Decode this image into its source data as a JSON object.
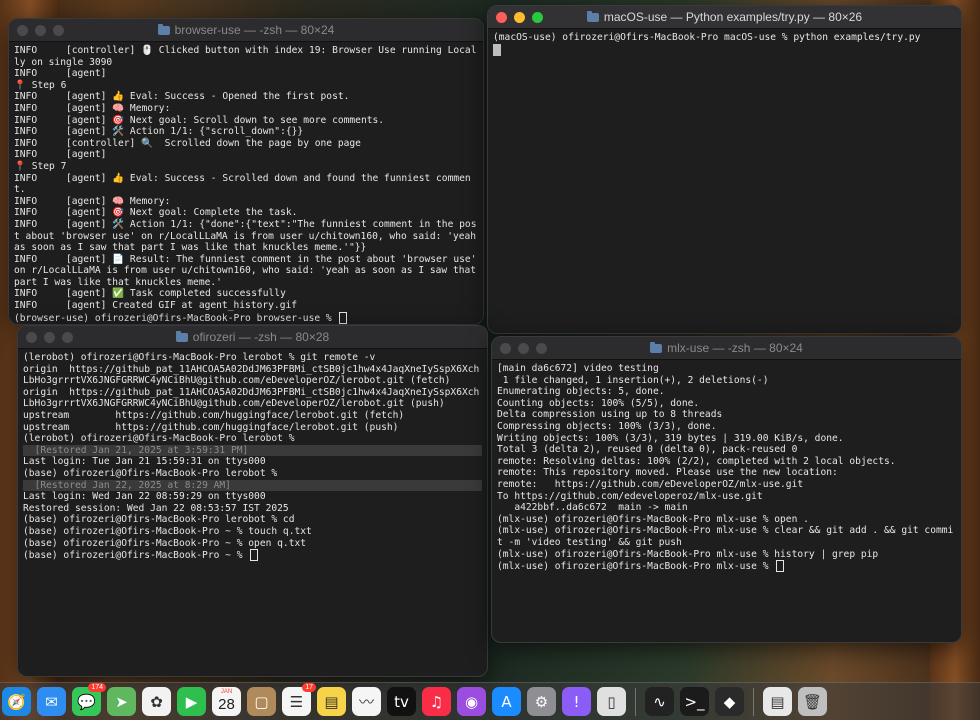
{
  "windows": {
    "browser": {
      "title": "browser-use — -zsh — 80×24",
      "lines": [
        "INFO     [controller] 🖱️ Clicked button with index 19: Browser Use running Locally on single 3090",
        "INFO     [agent]",
        "📍 Step 6",
        "INFO     [agent] 👍 Eval: Success - Opened the first post.",
        "INFO     [agent] 🧠 Memory:",
        "INFO     [agent] 🎯 Next goal: Scroll down to see more comments.",
        "INFO     [agent] 🛠️ Action 1/1: {\"scroll_down\":{}}",
        "INFO     [controller] 🔍  Scrolled down the page by one page",
        "INFO     [agent]",
        "📍 Step 7",
        "INFO     [agent] 👍 Eval: Success - Scrolled down and found the funniest comment.",
        "INFO     [agent] 🧠 Memory:",
        "INFO     [agent] 🎯 Next goal: Complete the task.",
        "INFO     [agent] 🛠️ Action 1/1: {\"done\":{\"text\":\"The funniest comment in the post about 'browser use' on r/LocalLLaMA is from user u/chitown160, who said: 'yeah as soon as I saw that part I was like that knuckles meme.'\"}}",
        "INFO     [agent] 📄 Result: The funniest comment in the post about 'browser use' on r/LocalLLaMA is from user u/chitown160, who said: 'yeah as soon as I saw that part I was like that knuckles meme.'",
        "INFO     [agent] ✅ Task completed successfully",
        "INFO     [agent] Created GIF at agent_history.gif"
      ],
      "prompt": "(browser-use) ofirozeri@Ofirs-MacBook-Pro browser-use % "
    },
    "macos": {
      "title": "macOS-use — Python examples/try.py — 80×26",
      "lines": [
        "(macOS-use) ofirozeri@Ofirs-MacBook-Pro macOS-use % python examples/try.py"
      ]
    },
    "lerobot": {
      "title": "ofirozeri — -zsh — 80×28",
      "lines": [
        {
          "text": "(lerobot) ofirozeri@Ofirs-MacBook-Pro lerobot % git remote -v",
          "restored": false
        },
        {
          "text": "origin  https://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@github.com/eDeveloperOZ/lerobot.git (fetch)",
          "restored": false
        },
        {
          "text": "origin  https://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@github.com/eDeveloperOZ/lerobot.git (push)",
          "restored": false
        },
        {
          "text": "upstream        https://github.com/huggingface/lerobot.git (fetch)",
          "restored": false
        },
        {
          "text": "upstream        https://github.com/huggingface/lerobot.git (push)",
          "restored": false
        },
        {
          "text": "(lerobot) ofirozeri@Ofirs-MacBook-Pro lerobot %",
          "restored": false
        },
        {
          "text": "  [Restored Jan 21, 2025 at 3:59:31 PM]",
          "restored": true
        },
        {
          "text": "Last login: Tue Jan 21 15:59:31 on ttys000",
          "restored": false
        },
        {
          "text": "(base) ofirozeri@Ofirs-MacBook-Pro lerobot %",
          "restored": false
        },
        {
          "text": "  [Restored Jan 22, 2025 at 8:29 AM]",
          "restored": true
        },
        {
          "text": "Last login: Wed Jan 22 08:59:29 on ttys000",
          "restored": false
        },
        {
          "text": "Restored session: Wed Jan 22 08:53:57 IST 2025",
          "restored": false
        },
        {
          "text": "(base) ofirozeri@Ofirs-MacBook-Pro lerobot % cd",
          "restored": false
        },
        {
          "text": "(base) ofirozeri@Ofirs-MacBook-Pro ~ % touch q.txt",
          "restored": false
        },
        {
          "text": "(base) ofirozeri@Ofirs-MacBook-Pro ~ % open q.txt",
          "restored": false
        }
      ],
      "prompt": "(base) ofirozeri@Ofirs-MacBook-Pro ~ % "
    },
    "mlx": {
      "title": "mlx-use — -zsh — 80×24",
      "lines": [
        "[main da6c672] video testing",
        " 1 file changed, 1 insertion(+), 2 deletions(-)",
        "Enumerating objects: 5, done.",
        "Counting objects: 100% (5/5), done.",
        "Delta compression using up to 8 threads",
        "Compressing objects: 100% (3/3), done.",
        "Writing objects: 100% (3/3), 319 bytes | 319.00 KiB/s, done.",
        "Total 3 (delta 2), reused 0 (delta 0), pack-reused 0",
        "remote: Resolving deltas: 100% (2/2), completed with 2 local objects.",
        "remote: This repository moved. Please use the new location:",
        "remote:   https://github.com/eDeveloperOZ/mlx-use.git",
        "To https://github.com/edeveloperoz/mlx-use.git",
        "   a422bbf..da6c672  main -> main",
        "(mlx-use) ofirozeri@Ofirs-MacBook-Pro mlx-use % open .",
        "(mlx-use) ofirozeri@Ofirs-MacBook-Pro mlx-use % clear && git add . && git commit -m 'video testing' && git push",
        "(mlx-use) ofirozeri@Ofirs-MacBook-Pro mlx-use % history | grep pip"
      ],
      "prompt": "(mlx-use) ofirozeri@Ofirs-MacBook-Pro mlx-use % "
    }
  },
  "dock": {
    "apps": [
      {
        "name": "safari-icon",
        "glyph": "🧭",
        "color": "#1e88e5"
      },
      {
        "name": "mail-icon",
        "glyph": "✉",
        "color": "#2f8cf0"
      },
      {
        "name": "messages-icon",
        "glyph": "💬",
        "color": "#34c759",
        "badge": "174"
      },
      {
        "name": "maps-icon",
        "glyph": "➤",
        "color": "#5fb85f"
      },
      {
        "name": "photos-icon",
        "glyph": "✿",
        "color": "#f2f2f2"
      },
      {
        "name": "facetime-icon",
        "glyph": "▶",
        "color": "#2fbf4f"
      },
      {
        "name": "calendar-icon",
        "glyph": "",
        "color": "#f5f5f5",
        "month": "JAN",
        "day": "28"
      },
      {
        "name": "finder-app-icon",
        "glyph": "▢",
        "color": "#b08a5a"
      },
      {
        "name": "reminders-icon",
        "glyph": "☰",
        "color": "#f5f5f5",
        "badge": "17"
      },
      {
        "name": "notes-icon",
        "glyph": "▤",
        "color": "#f7d34a"
      },
      {
        "name": "freeform-icon",
        "glyph": "〰",
        "color": "#f5f5f5"
      },
      {
        "name": "appletv-icon",
        "glyph": "tv",
        "color": "#111111"
      },
      {
        "name": "music-icon",
        "glyph": "♫",
        "color": "#fa2d48"
      },
      {
        "name": "podcasts-icon",
        "glyph": "◉",
        "color": "#9b4de0"
      },
      {
        "name": "appstore-icon",
        "glyph": "A",
        "color": "#1a8cff"
      },
      {
        "name": "settings-icon",
        "glyph": "⚙",
        "color": "#8e8e93"
      },
      {
        "name": "feedback-icon",
        "glyph": "!",
        "color": "#8b5cf6"
      },
      {
        "name": "iphone-mirroring-icon",
        "glyph": "▯",
        "color": "#e0e0e0"
      }
    ],
    "apps2": [
      {
        "name": "activity-monitor-icon",
        "glyph": "∿",
        "color": "#222222"
      },
      {
        "name": "terminal-icon",
        "glyph": ">_",
        "color": "#1b1b1b"
      },
      {
        "name": "cursor-app-icon",
        "glyph": "◆",
        "color": "#2a2a2a"
      }
    ],
    "trash": [
      {
        "name": "document-icon",
        "glyph": "▤",
        "color": "#e8e8e8"
      },
      {
        "name": "trash-icon",
        "glyph": "🗑",
        "color": "#bfbfbf"
      }
    ]
  }
}
